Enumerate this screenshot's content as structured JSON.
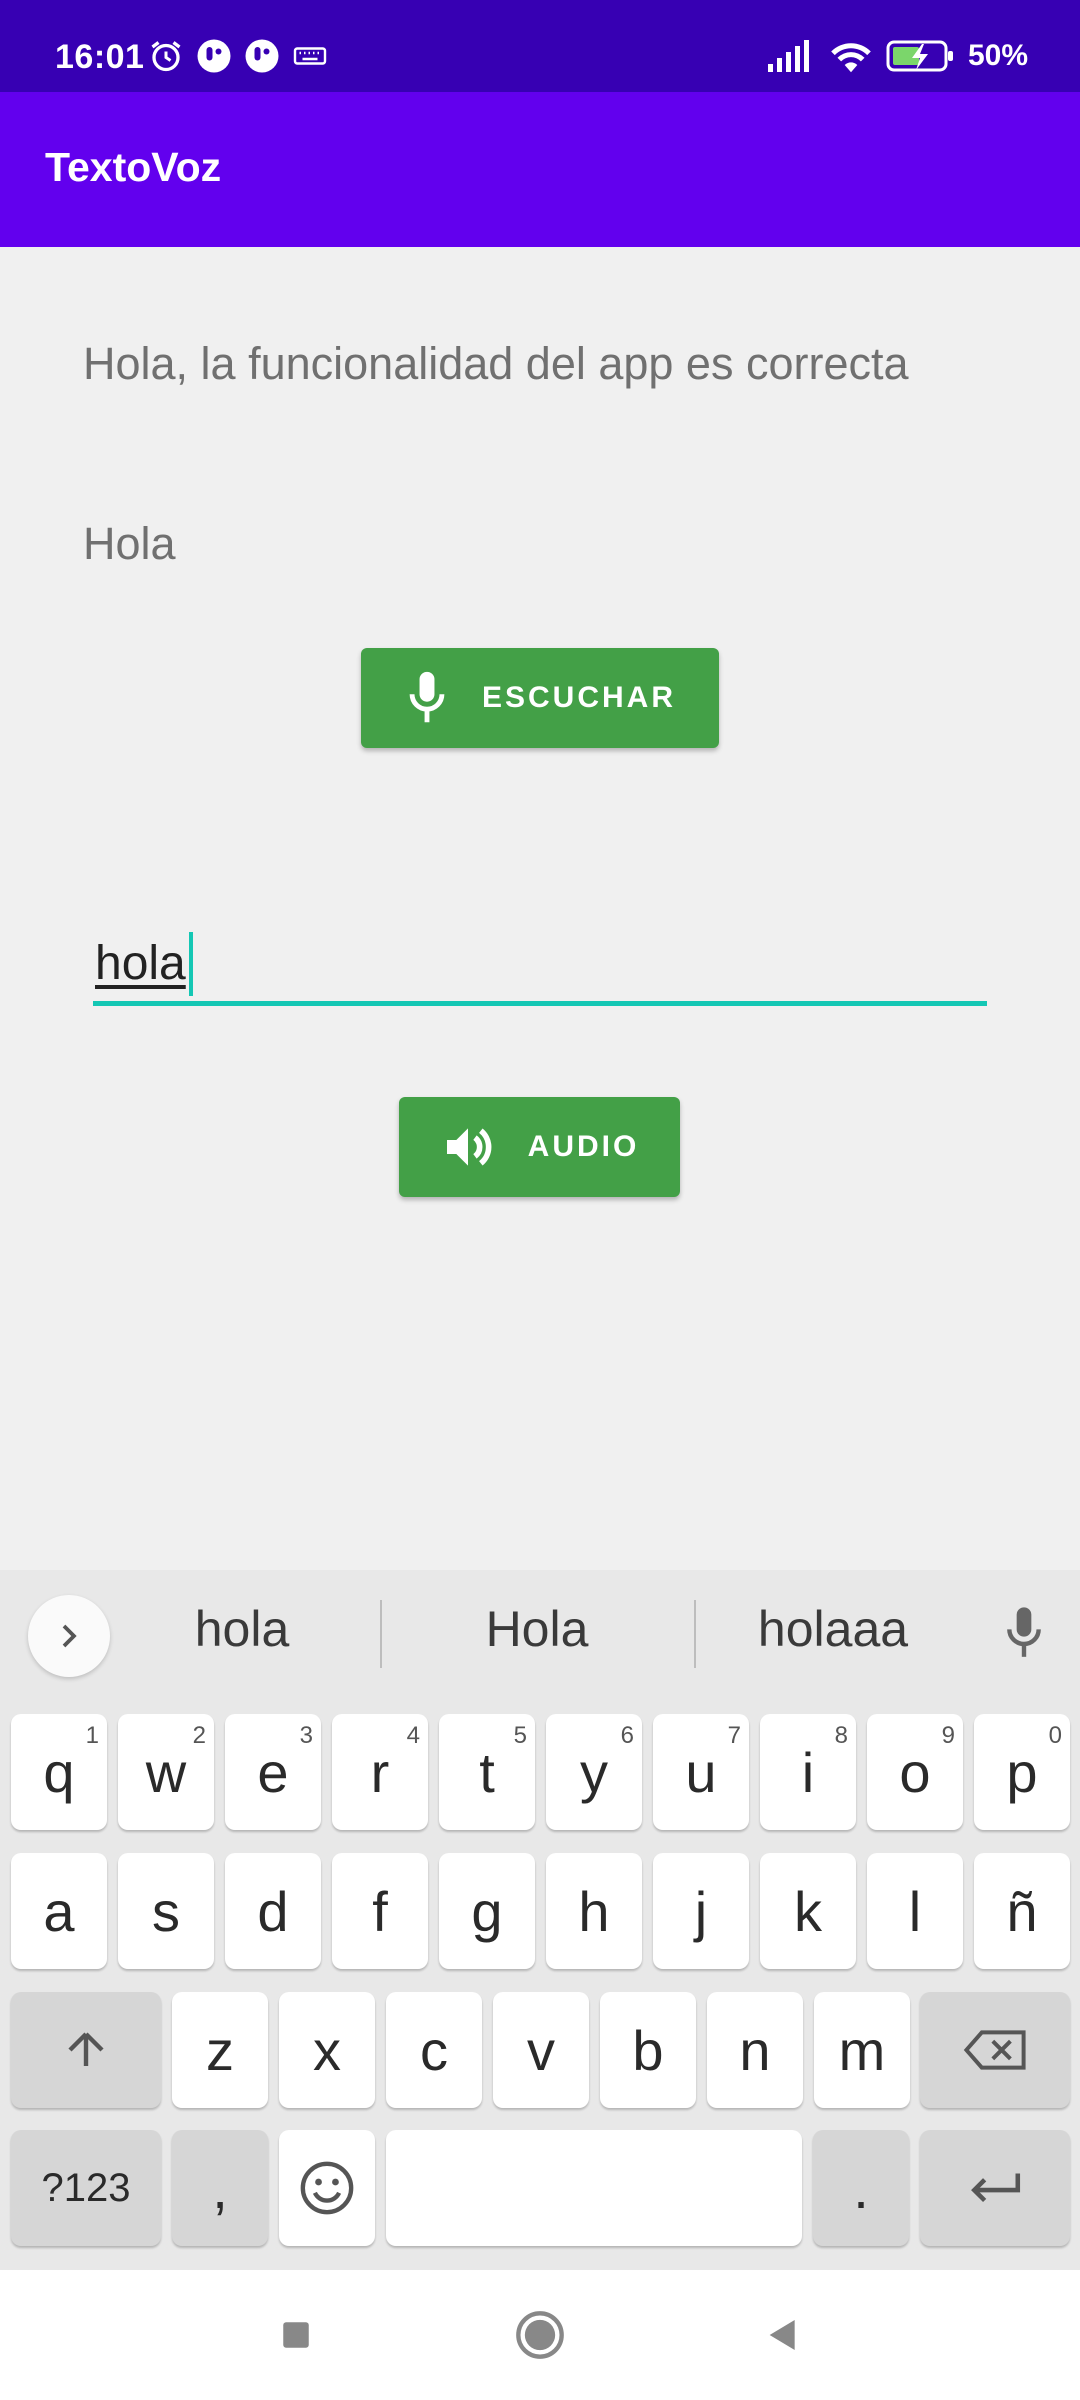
{
  "status_bar": {
    "time": "16:01",
    "battery": "50%",
    "icons_left": [
      "alarm-icon",
      "app-notification-icon",
      "app-notification-icon",
      "keyboard-icon"
    ],
    "icons_right": [
      "signal-icon",
      "wifi-icon",
      "battery-charging-icon"
    ]
  },
  "app_bar": {
    "title": "TextoVoz"
  },
  "main": {
    "recognized_text": "Hola, la funcionalidad del app es correcta",
    "short_text": "Hola",
    "listen_button": {
      "label": "ESCUCHAR",
      "icon": "microphone-icon"
    },
    "input": {
      "value": "hola"
    },
    "audio_button": {
      "label": "AUDIO",
      "icon": "speaker-icon"
    }
  },
  "keyboard": {
    "suggestions": [
      "hola",
      "Hola",
      "holaaa"
    ],
    "row1": [
      {
        "label": "q",
        "num": "1"
      },
      {
        "label": "w",
        "num": "2"
      },
      {
        "label": "e",
        "num": "3"
      },
      {
        "label": "r",
        "num": "4"
      },
      {
        "label": "t",
        "num": "5"
      },
      {
        "label": "y",
        "num": "6"
      },
      {
        "label": "u",
        "num": "7"
      },
      {
        "label": "i",
        "num": "8"
      },
      {
        "label": "o",
        "num": "9"
      },
      {
        "label": "p",
        "num": "0"
      }
    ],
    "row2": [
      "a",
      "s",
      "d",
      "f",
      "g",
      "h",
      "j",
      "k",
      "l",
      "ñ"
    ],
    "row3": [
      "z",
      "x",
      "c",
      "v",
      "b",
      "n",
      "m"
    ],
    "symbols_label": "?123",
    "comma_label": ",",
    "period_label": "."
  },
  "colors": {
    "status_bar": "#3700b3",
    "app_bar": "#6200ee",
    "button": "#43a047",
    "accent": "#14c7b4"
  }
}
